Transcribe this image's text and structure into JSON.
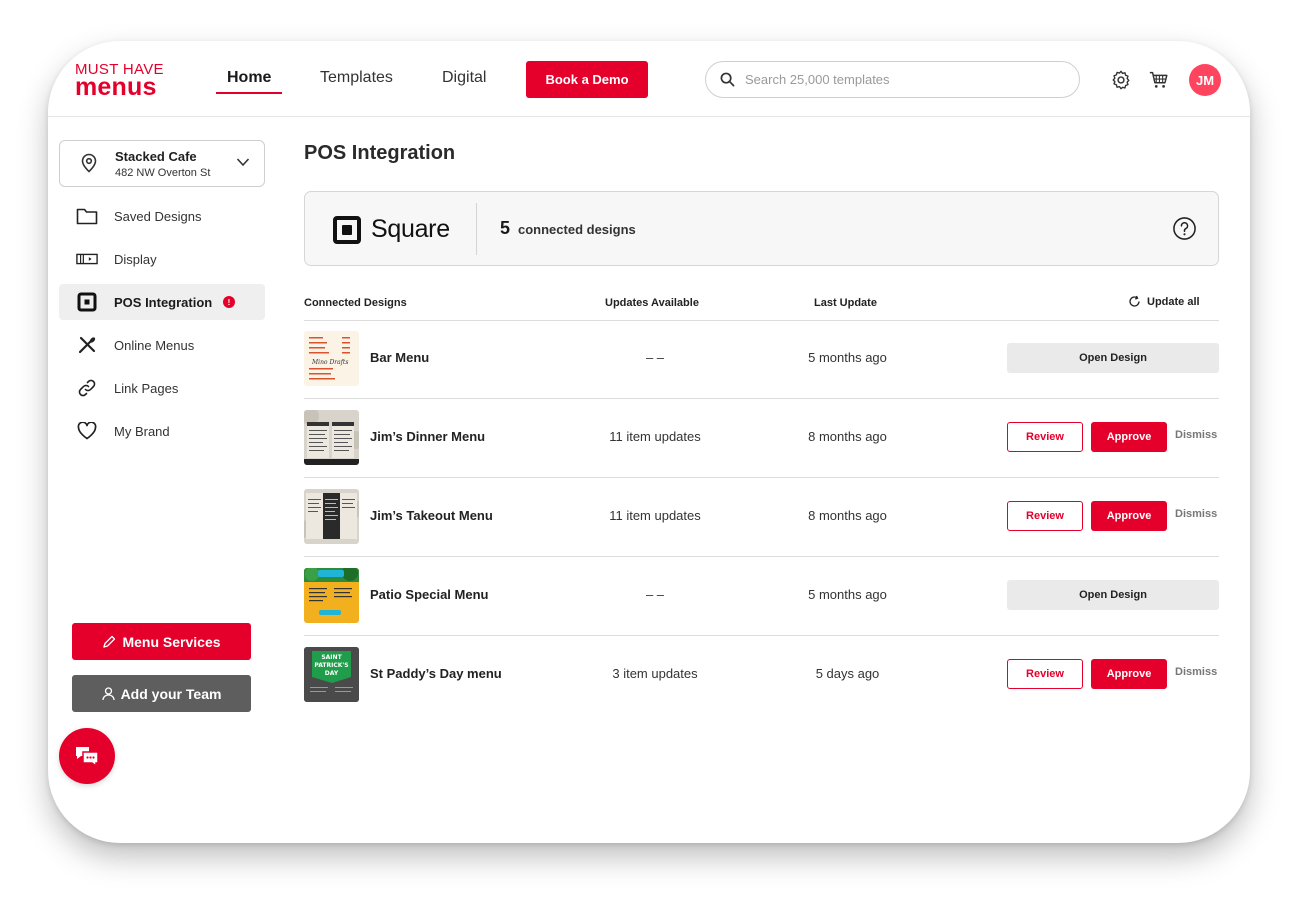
{
  "brand": {
    "line1": "MUST HAVE",
    "line2": "menus",
    "accent": "#e4002b"
  },
  "nav": {
    "home": "Home",
    "templates": "Templates",
    "digital": "Digital",
    "demo": "Book a Demo"
  },
  "search": {
    "placeholder": "Search 25,000 templates"
  },
  "user": {
    "initials": "JM"
  },
  "location": {
    "name": "Stacked Cafe",
    "address": "482 NW Overton St"
  },
  "sidebar": {
    "items": [
      {
        "label": "Saved Designs",
        "icon": "folder-icon"
      },
      {
        "label": "Display",
        "icon": "display-icon"
      },
      {
        "label": "POS Integration",
        "icon": "square-pos-icon",
        "active": true,
        "badge": "!"
      },
      {
        "label": "Online Menus",
        "icon": "utensils-icon"
      },
      {
        "label": "Link Pages",
        "icon": "link-icon"
      },
      {
        "label": "My Brand",
        "icon": "heart-icon"
      }
    ],
    "menu_services": "Menu Services",
    "add_team": "Add your Team"
  },
  "page": {
    "title": "POS Integration",
    "provider": "Square",
    "connected_count": "5",
    "connected_label": "connected designs"
  },
  "table": {
    "headers": {
      "designs": "Connected Designs",
      "updates": "Updates Available",
      "last": "Last Update",
      "update_all": "Update all"
    },
    "rows": [
      {
        "name": "Bar Menu",
        "updates": "– –",
        "last": "5 months ago",
        "action": "open"
      },
      {
        "name": "Jim’s Dinner Menu",
        "updates": "11 item updates",
        "last": "8 months ago",
        "action": "review"
      },
      {
        "name": "Jim’s Takeout Menu",
        "updates": "11 item updates",
        "last": "8 months ago",
        "action": "review"
      },
      {
        "name": "Patio Special Menu",
        "updates": "– –",
        "last": "5 months ago",
        "action": "open"
      },
      {
        "name": "St Paddy’s Day menu",
        "updates": "3 item updates",
        "last": "5 days ago",
        "action": "review"
      }
    ],
    "actions": {
      "open": "Open Design",
      "review": "Review",
      "approve": "Approve",
      "dismiss": "Dismiss"
    }
  },
  "thumb_text": {
    "mino": "Mino Drafts",
    "saint": "SAINT",
    "patricks": "PATRICK'S",
    "day": "DAY"
  }
}
